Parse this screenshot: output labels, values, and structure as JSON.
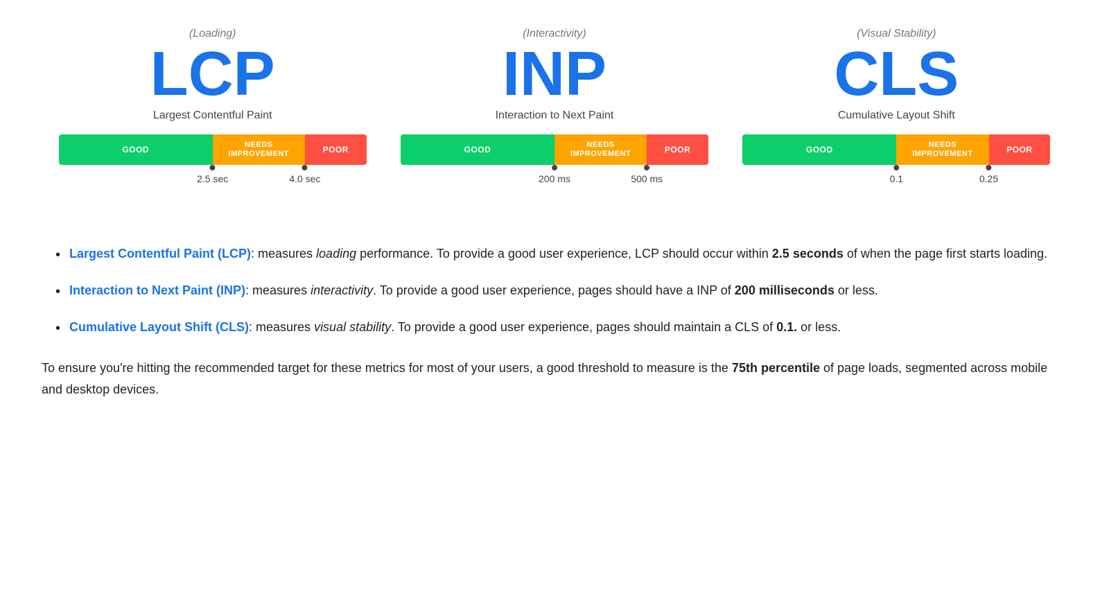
{
  "metrics": [
    {
      "id": "lcp",
      "subtitle": "(Loading)",
      "acronym": "LCP",
      "fullname": "Largest Contentful Paint",
      "bar": {
        "good_label": "GOOD",
        "needs_label": "NEEDS\nIMPROVEMENT",
        "poor_label": "POOR"
      },
      "marker1_label": "2.5 sec",
      "marker2_label": "4.0 sec"
    },
    {
      "id": "inp",
      "subtitle": "(Interactivity)",
      "acronym": "INP",
      "fullname": "Interaction to Next Paint",
      "bar": {
        "good_label": "GOOD",
        "needs_label": "NEEDS\nIMPROVEMENT",
        "poor_label": "POOR"
      },
      "marker1_label": "200 ms",
      "marker2_label": "500 ms"
    },
    {
      "id": "cls",
      "subtitle": "(Visual Stability)",
      "acronym": "CLS",
      "fullname": "Cumulative Layout Shift",
      "bar": {
        "good_label": "GOOD",
        "needs_label": "NEEDS\nIMPROVEMENT",
        "poor_label": "POOR"
      },
      "marker1_label": "0.1",
      "marker2_label": "0.25"
    }
  ],
  "bullets": [
    {
      "link": "Largest Contentful Paint (LCP)",
      "text1": ": measures ",
      "italic1": "loading",
      "text2": " performance. To provide a good user experience, LCP should occur within ",
      "bold1": "2.5 seconds",
      "text3": " of when the page first starts loading."
    },
    {
      "link": "Interaction to Next Paint (INP)",
      "text1": ": measures ",
      "italic1": "interactivity",
      "text2": ". To provide a good user experience, pages should have a INP of ",
      "bold1": "200 milliseconds",
      "text3": " or less."
    },
    {
      "link": "Cumulative Layout Shift (CLS)",
      "text1": ": measures ",
      "italic1": "visual stability",
      "text2": ". To provide a good user experience, pages should maintain a CLS of ",
      "bold1": "0.1.",
      "text3": " or less."
    }
  ],
  "footer": {
    "text1": "To ensure you're hitting the recommended target for these metrics for most of your users, a good threshold to measure is the ",
    "bold1": "75th percentile",
    "text2": " of page loads, segmented across mobile and desktop devices."
  }
}
